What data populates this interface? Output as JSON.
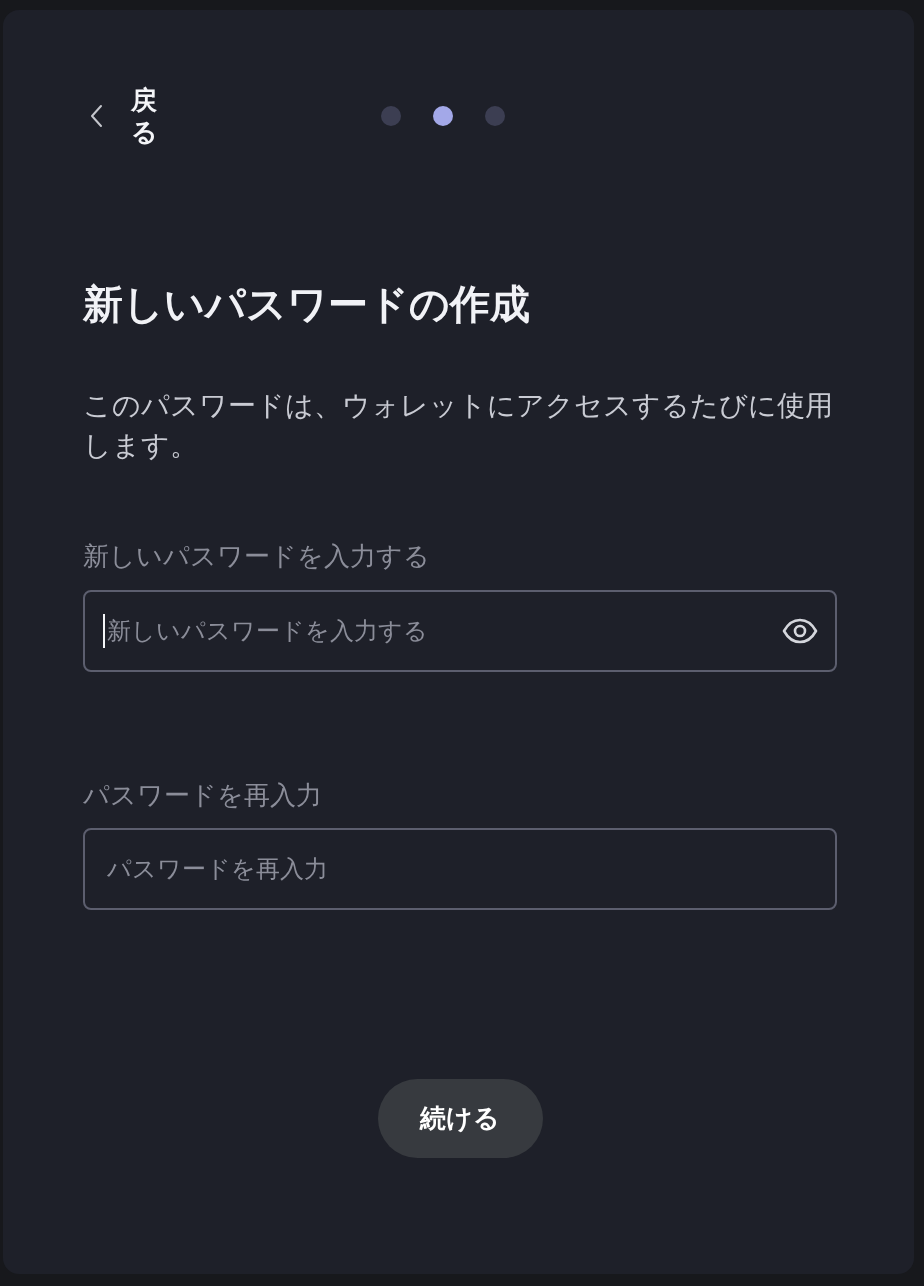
{
  "back": {
    "label": "戻る"
  },
  "steps": [
    {
      "selected": false
    },
    {
      "selected": true
    },
    {
      "selected": false
    }
  ],
  "title": "新しいパスワードの作成",
  "description": "このパスワードは、ウォレットにアクセスするたびに使用します。",
  "fields": [
    {
      "label": "新しいパスワードを入力する",
      "placeholder": "新しいパスワードを入力する",
      "focused": true,
      "reveal_toggle": true
    },
    {
      "label": "パスワードを再入力",
      "placeholder": "パスワードを再入力",
      "focused": false,
      "reveal_toggle": false
    }
  ],
  "primary_button": {
    "label": "続ける"
  }
}
